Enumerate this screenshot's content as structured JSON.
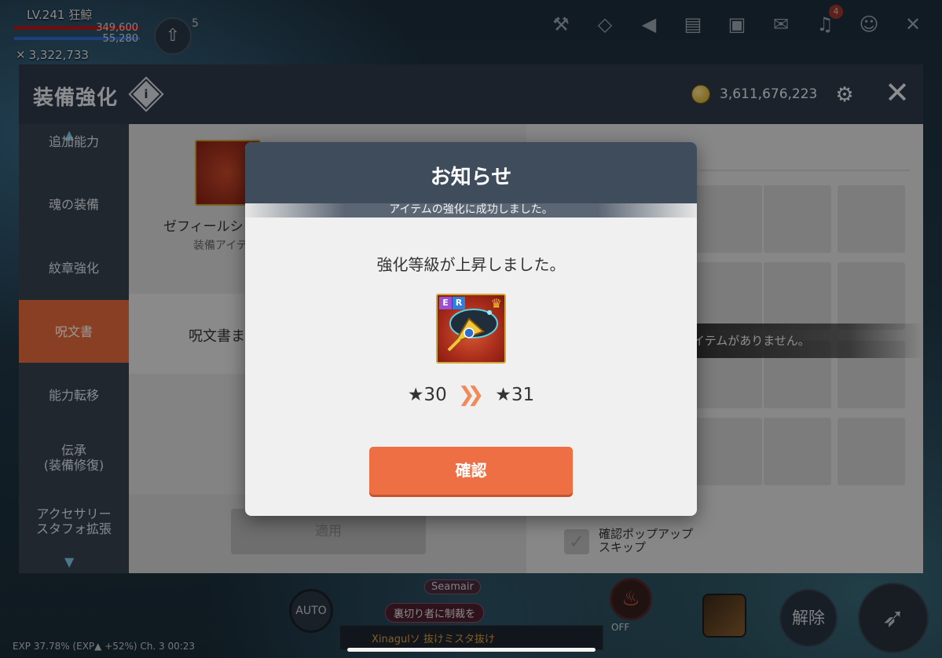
{
  "hud": {
    "level": "LV.241  狂鯨",
    "hp": "349,600",
    "mp": "55,280",
    "combat_power": "3,322,733",
    "level_up_count": "5",
    "bell_badge": "4",
    "bottom": {
      "auto_label": "AUTO",
      "party_name": "Seamair",
      "party_status": "裏切り者に制裁を",
      "chat_preview": "Xinagulソ 抜けミスタ抜け",
      "off_label": "OFF",
      "release_label": "解除",
      "exp_line": "EXP  37.78%  (EXP▲ +52%)  Ch. 3   00:23"
    }
  },
  "panel": {
    "title": "装備強化",
    "gold": "3,611,676,223",
    "sidebar": [
      {
        "label": "追加能力"
      },
      {
        "label": "魂の装備"
      },
      {
        "label": "紋章強化"
      },
      {
        "label": "呪文書"
      },
      {
        "label": "能力転移"
      },
      {
        "label": "伝承\n(装備修復)"
      },
      {
        "label": "アクセサリー\nスタフォ拡張"
      }
    ],
    "active_index": 3,
    "item_name": "ゼフィールシ",
    "item_sub": "装備アイテ",
    "scroll_label": "呪文書ま",
    "apply_label": "適用",
    "no_item_text": "イテムがありません。",
    "skip_label": "確認ポップアップ\nスキップ"
  },
  "modal": {
    "title": "お知らせ",
    "subtitle": "アイテムの強化に成功しました。",
    "message": "強化等級が上昇しました。",
    "grade_from": "★30",
    "grade_to": "★31",
    "badge_e": "E",
    "badge_r": "R",
    "confirm_label": "確認"
  }
}
